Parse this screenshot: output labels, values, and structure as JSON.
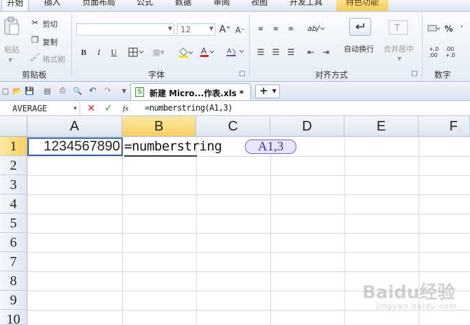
{
  "ribbon_tabs": [
    "开始",
    "插入",
    "页面布局",
    "公式",
    "数据",
    "审阅",
    "视图",
    "开发工具",
    "特色功能"
  ],
  "clipboard": {
    "paste": "粘贴",
    "cut": "剪切",
    "copy": "复制",
    "format_painter": "格式刷",
    "label": "剪贴板"
  },
  "font": {
    "name": "",
    "size": "12",
    "label": "字体",
    "grow": "A⁺",
    "shrink": "A⁻",
    "bold": "B",
    "italic": "I",
    "underline": "U"
  },
  "alignment": {
    "wrap": "自动换行",
    "merge": "合并居中",
    "label": "对齐方式"
  },
  "number": {
    "label": "数字",
    "percent": "%",
    "inc_decimal": "+.0\n.00",
    "dec_decimal": ".00\n+.0"
  },
  "doc_tab": {
    "label": "新建 Micro...作表.xls *",
    "icon_text": "S",
    "new_tab": "+"
  },
  "formula_bar": {
    "name_box": "AVERAGE",
    "cancel": "✕",
    "confirm": "✓",
    "fx": "fx",
    "formula": "=numberstring(A1,3)"
  },
  "columns": [
    "A",
    "B",
    "C",
    "D",
    "E",
    "F"
  ],
  "rows": [
    "1",
    "2",
    "3",
    "4",
    "5",
    "6",
    "7",
    "8",
    "9",
    "10"
  ],
  "cells": {
    "A1": "1234567890",
    "B1": "=numberstring",
    "B1_ref": "A1,3"
  },
  "watermark": {
    "brand": "Baidu经验",
    "url": "jingyan.baidu.com"
  }
}
